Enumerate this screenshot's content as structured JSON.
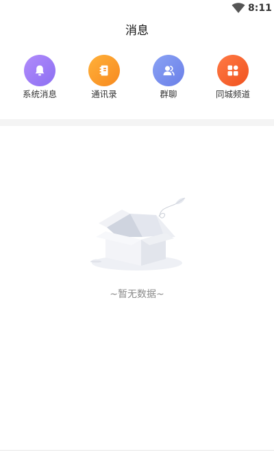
{
  "status_bar": {
    "time": "8:11",
    "wifi_icon": "wifi-icon"
  },
  "header": {
    "title": "消息"
  },
  "quick_actions": [
    {
      "label": "系统消息",
      "icon": "bell-icon",
      "color": "#9a7cf7"
    },
    {
      "label": "通讯录",
      "icon": "contacts-book-icon",
      "color": "#f9a02b"
    },
    {
      "label": "群聊",
      "icon": "group-chat-icon",
      "color": "#7a8fee"
    },
    {
      "label": "同城频道",
      "icon": "grid-apps-icon",
      "color": "#f56530"
    }
  ],
  "empty_state": {
    "text": "~暂无数据~",
    "illustration": "empty-box-icon"
  }
}
